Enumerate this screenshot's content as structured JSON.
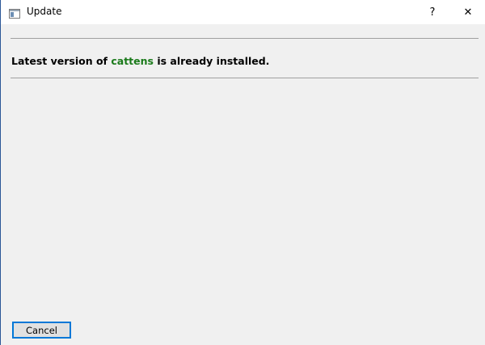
{
  "window": {
    "title": "Update",
    "help_glyph": "?",
    "close_glyph": "✕",
    "icons": [
      "app-window-icon",
      "help-icon",
      "close-icon"
    ]
  },
  "message": {
    "prefix": "Latest version of ",
    "package": "cattens",
    "suffix": " is already installed.",
    "package_color": "#1a7a1a"
  },
  "buttons": {
    "cancel_label": "Cancel",
    "focus_color": "#0078d7"
  }
}
